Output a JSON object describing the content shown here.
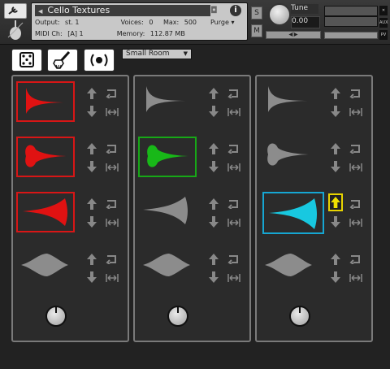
{
  "header": {
    "instrument_title": "Cello Textures",
    "output_label": "Output:",
    "output_value": "st. 1",
    "midi_label": "MIDI Ch:",
    "midi_value": "[A]  1",
    "voices_label": "Voices:",
    "voices_value": "0",
    "max_label": "Max:",
    "max_value": "500",
    "purge_label": "Purge",
    "memory_label": "Memory:",
    "memory_value": "112.87 MB",
    "s_label": "S",
    "m_label": "M",
    "tune_label": "Tune",
    "tune_value": "0.00",
    "aux_label": "AUX",
    "pv_label": "PV"
  },
  "toolbar": {
    "reverb_value": "Small Room"
  },
  "colors": {
    "red": "#e01212",
    "green": "#18b818",
    "cyan": "#18c8e0",
    "grey": "#8c8c8c",
    "yellow": "#f0e000"
  }
}
